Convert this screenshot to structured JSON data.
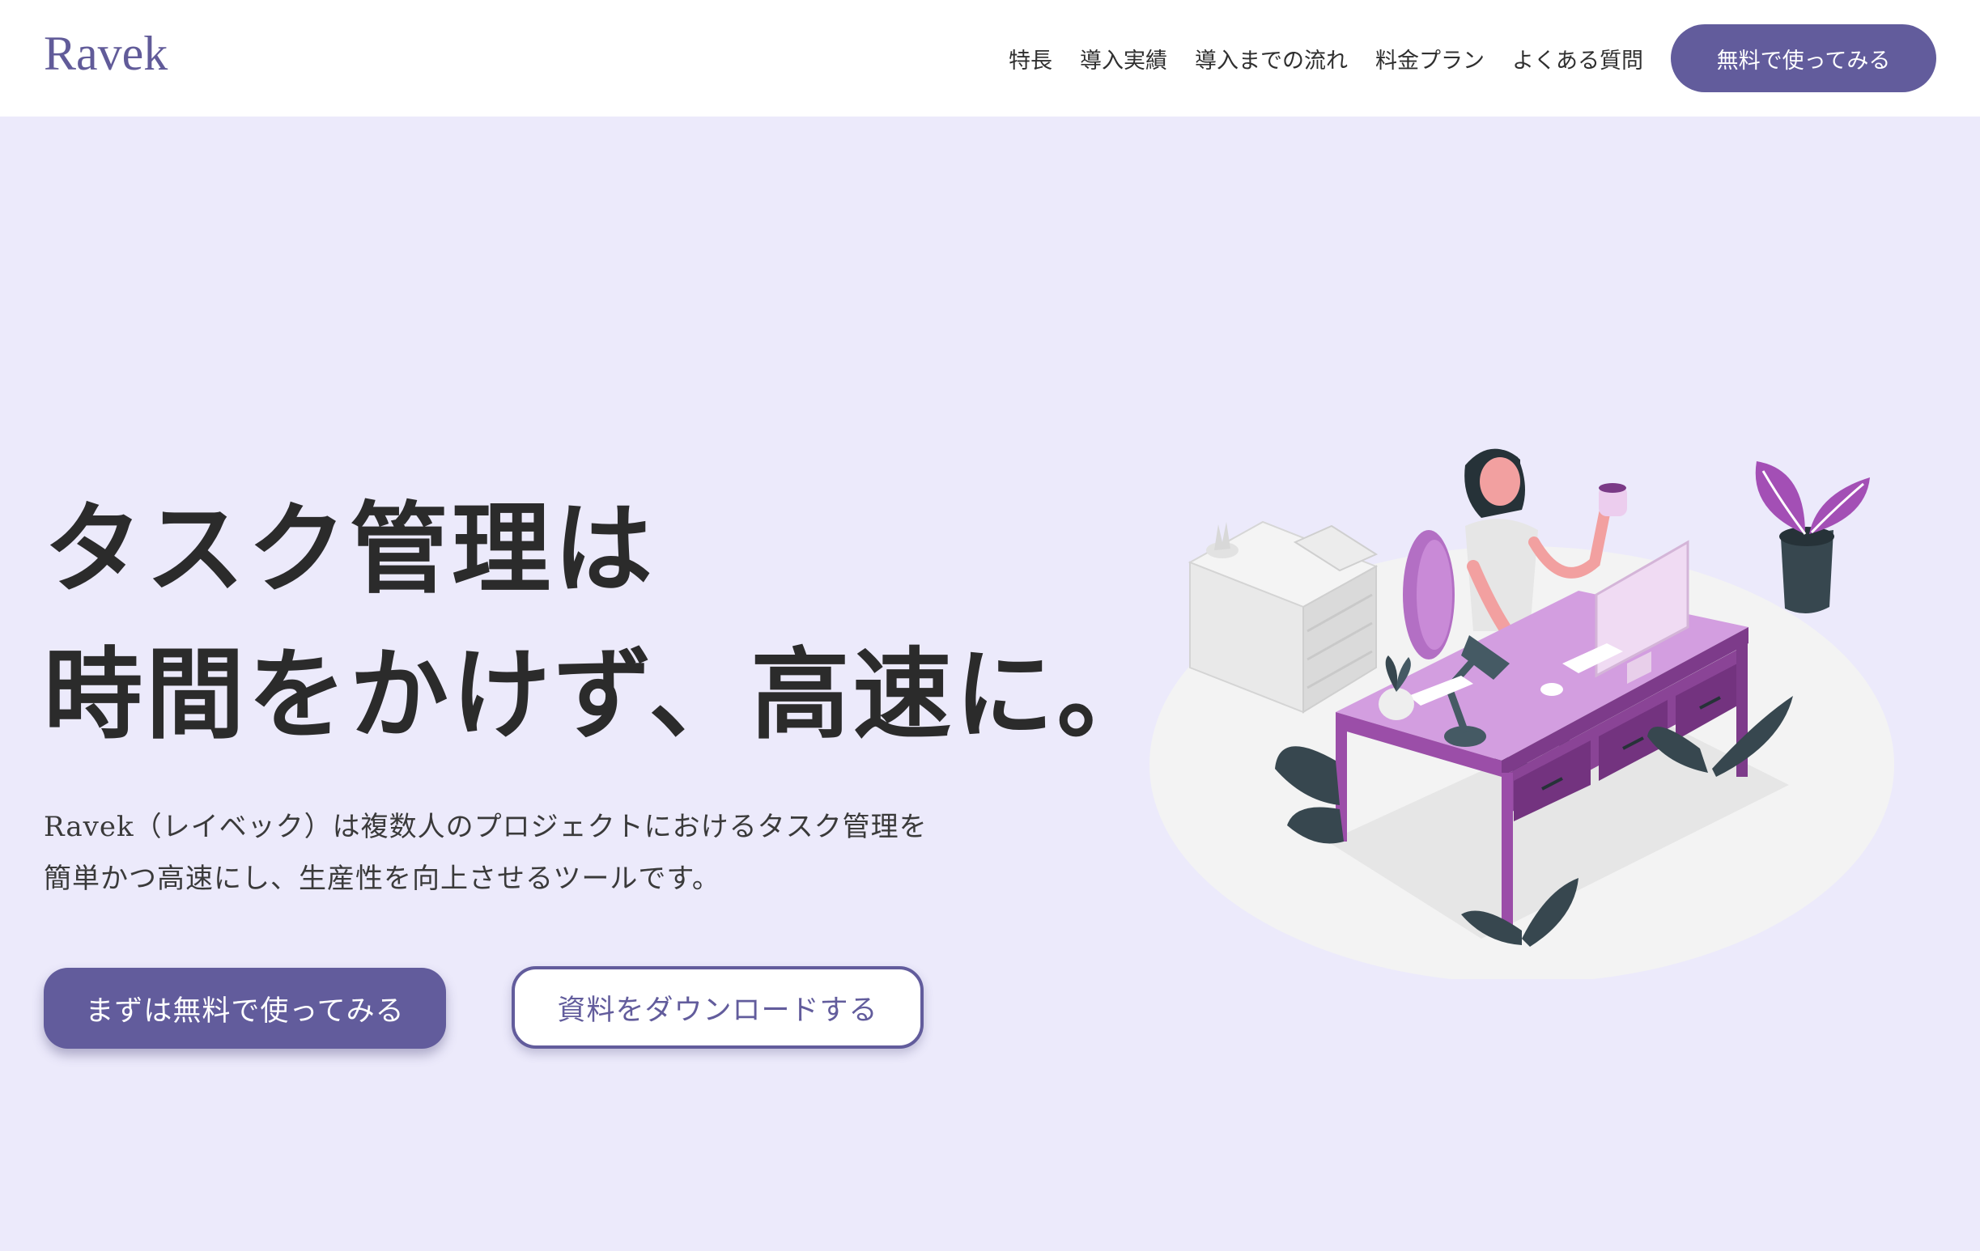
{
  "header": {
    "logo": "Ravek",
    "nav": [
      {
        "label": "特長"
      },
      {
        "label": "導入実績"
      },
      {
        "label": "導入までの流れ"
      },
      {
        "label": "料金プラン"
      },
      {
        "label": "よくある質問"
      }
    ],
    "cta_label": "無料で使ってみる"
  },
  "hero": {
    "title_line1": "タスク管理は",
    "title_line2": "時間をかけず、高速に。",
    "desc_line1": "Ravek（レイベック）は複数人のプロジェクトにおけるタスク管理を",
    "desc_line2": "簡単かつ高速にし、生産性を向上させるツールです。",
    "primary_button": "まずは無料で使ってみる",
    "secondary_button": "資料をダウンロードする"
  },
  "colors": {
    "brand": "#625c9c",
    "background": "#eceafb",
    "header_bg": "#ffffff",
    "accent_purple": "#9c5aa8"
  },
  "illustration": {
    "icon": "woman-at-desk-illustration"
  }
}
